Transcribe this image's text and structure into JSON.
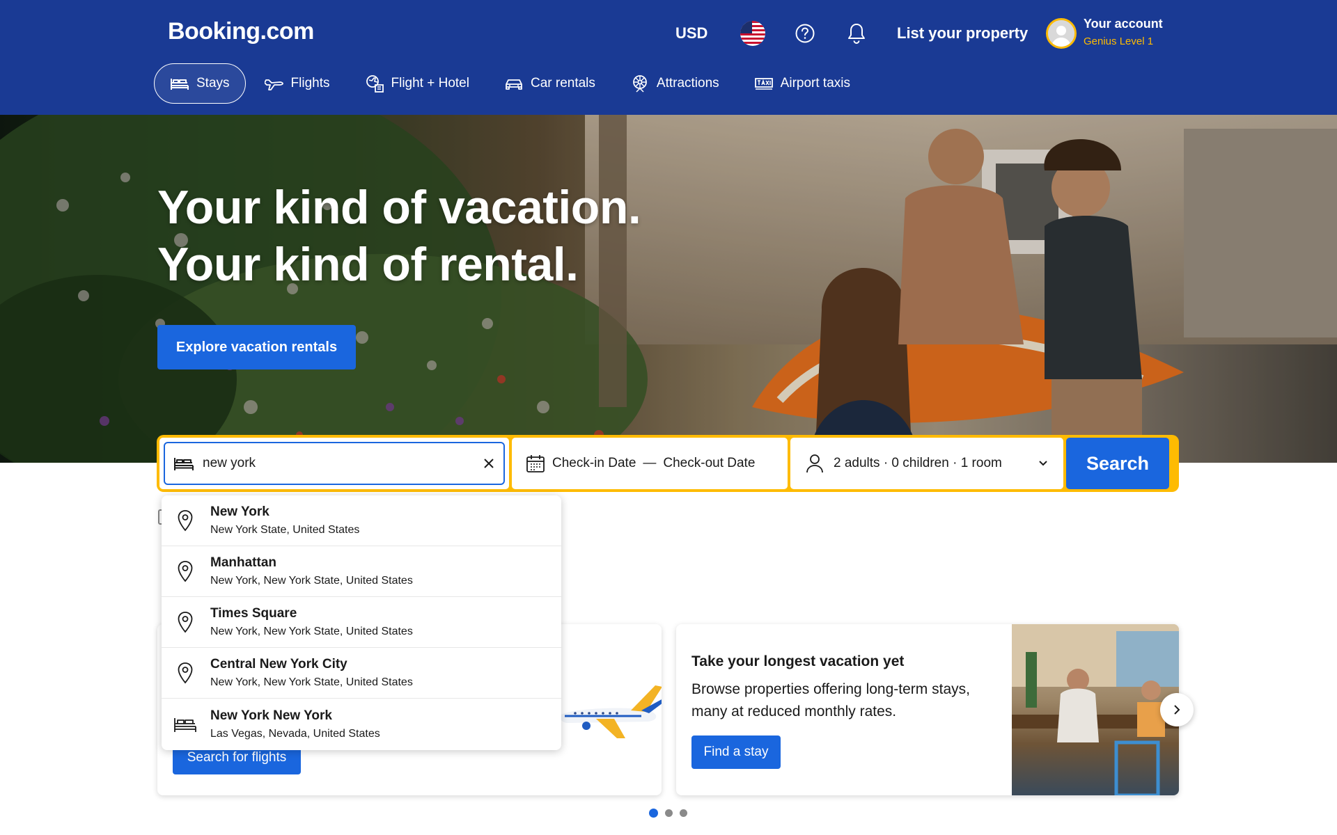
{
  "header": {
    "logo": "Booking.com",
    "currency": "USD",
    "list_property": "List your property",
    "account_title": "Your account",
    "account_level": "Genius Level 1"
  },
  "nav": [
    {
      "label": "Stays",
      "icon": "bed-icon",
      "active": true
    },
    {
      "label": "Flights",
      "icon": "plane-icon"
    },
    {
      "label": "Flight + Hotel",
      "icon": "flight-hotel-icon"
    },
    {
      "label": "Car rentals",
      "icon": "car-icon"
    },
    {
      "label": "Attractions",
      "icon": "attractions-icon"
    },
    {
      "label": "Airport taxis",
      "icon": "taxi-icon"
    }
  ],
  "hero": {
    "line1": "Your kind of vacation.",
    "line2": "Your kind of rental.",
    "cta": "Explore vacation rentals"
  },
  "search": {
    "destination_value": "new york",
    "checkin": "Check-in Date",
    "dash": "—",
    "checkout": "Check-out Date",
    "guests": "2 adults · 0 children · 1 room",
    "button": "Search"
  },
  "suggestions": [
    {
      "name": "New York",
      "sub": "New York State, United States",
      "icon": "location-pin-icon"
    },
    {
      "name": "Manhattan",
      "sub": "New York, New York State, United States",
      "icon": "location-pin-icon"
    },
    {
      "name": "Times Square",
      "sub": "New York, New York State, United States",
      "icon": "location-pin-icon"
    },
    {
      "name": "Central New York City",
      "sub": "New York, New York State, United States",
      "icon": "location-pin-icon"
    },
    {
      "name": "New York New York",
      "sub": "Las Vegas, Nevada, United States",
      "icon": "bed-icon"
    }
  ],
  "cards": {
    "card1_button": "Search for flights",
    "card2_title": "Take your longest vacation yet",
    "card2_desc": "Browse properties offering long-term stays, many at reduced monthly rates.",
    "card2_button": "Find a stay"
  },
  "colors": {
    "brand_blue": "#1a3a94",
    "action_blue": "#1a66de",
    "accent_yellow": "#febb02"
  }
}
